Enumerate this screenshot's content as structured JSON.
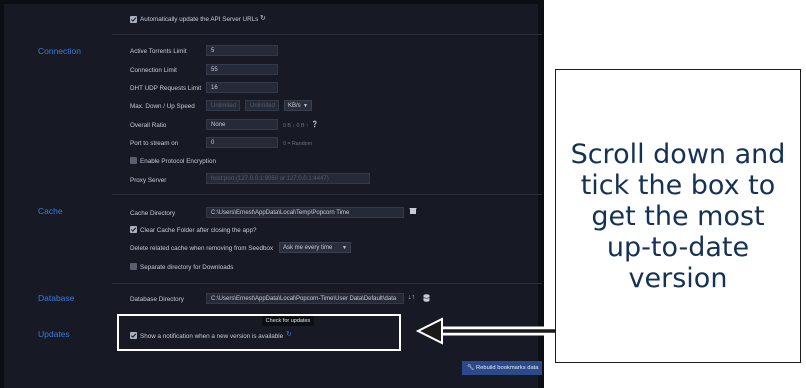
{
  "sections": {
    "connection": "Connection",
    "cache": "Cache",
    "database": "Database",
    "updates": "Updates"
  },
  "api": {
    "auto_update_label": "Automatically update the API Server URLs",
    "checked": true
  },
  "connection": {
    "active_torrents_label": "Active Torrents Limit",
    "active_torrents_value": "5",
    "connection_limit_label": "Connection Limit",
    "connection_limit_value": "55",
    "dht_label": "DHT UDP Requests Limit",
    "dht_value": "16",
    "speed_label": "Max. Down / Up Speed",
    "down_placeholder": "Unlimited",
    "up_placeholder": "Unlimited",
    "speed_unit": "KB/s",
    "ratio_label": "Overall Ratio",
    "ratio_value": "None",
    "ratio_info": "0 B ↓  0 B ↑",
    "port_label": "Port to stream on",
    "port_value": "0",
    "port_hint": "0 = Random",
    "encryption_label": "Enable Protocol Encryption",
    "encryption_checked": false,
    "proxy_label": "Proxy Server",
    "proxy_placeholder": "host:port (127.0.0.1:9050 or 127.0.0.1:4447)"
  },
  "cache": {
    "dir_label": "Cache Directory",
    "dir_value": "C:\\Users\\Ernest\\AppData\\Local\\Temp\\Popcorn Time",
    "clear_label": "Clear Cache Folder after closing the app?",
    "clear_checked": true,
    "seedbox_label": "Delete related cache when removing from Seedbox",
    "seedbox_value": "Ask me every time",
    "separate_label": "Separate directory for Downloads",
    "separate_checked": false
  },
  "database": {
    "dir_label": "Database Directory",
    "dir_value": "C:\\Users\\Ernest\\AppData\\Local\\Popcorn-Time\\User Data\\Default\\data"
  },
  "updates": {
    "tooltip": "Check for updates",
    "notify_label": "Show a notification when a new version is available",
    "notify_checked": true
  },
  "rebuild_label": "Rebuild bookmarks data",
  "callout": "Scroll down and tick the box to get the most up-to-date version",
  "colors": {
    "accent": "#3f78d6",
    "callout_text": "#143253",
    "app_bg": "#171a24"
  }
}
